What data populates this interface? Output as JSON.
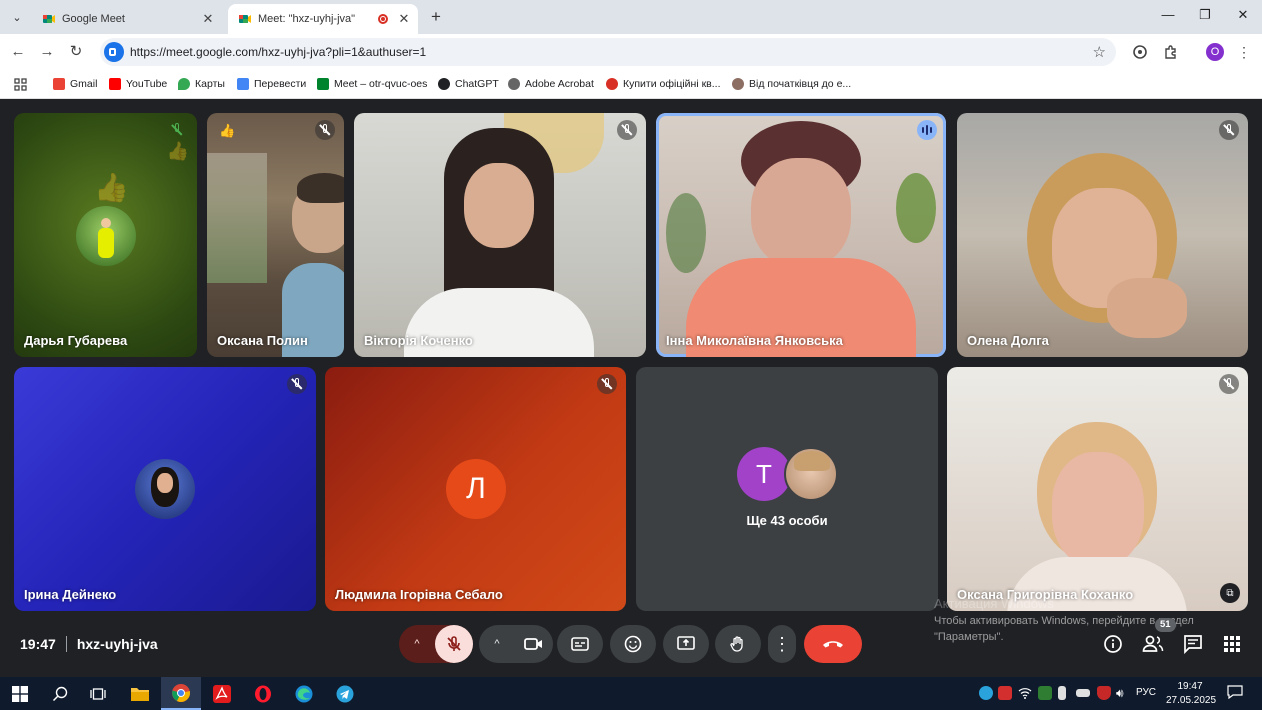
{
  "browser": {
    "tabs": [
      {
        "title": "Google Meet",
        "active": false
      },
      {
        "title": "Meet: \"hxz-uyhj-jva\"",
        "active": true
      }
    ],
    "url": "https://meet.google.com/hxz-uyhj-jva?pli=1&authuser=1",
    "profile_initial": "O",
    "bookmarks": [
      {
        "label": "Gmail",
        "color": "#ea4335"
      },
      {
        "label": "YouTube",
        "color": "#ff0000"
      },
      {
        "label": "Карты",
        "color": "#34a853"
      },
      {
        "label": "Перевести",
        "color": "#4285f4"
      },
      {
        "label": "Meet – otr-qvuc-oes",
        "color": "#00832d"
      },
      {
        "label": "ChatGPT",
        "color": "#202124"
      },
      {
        "label": "Adobe Acrobat",
        "color": "#444444"
      },
      {
        "label": "Купити офіційні кв...",
        "color": "#d93025"
      },
      {
        "label": "Від початківця до е...",
        "color": "#8d6e63"
      }
    ]
  },
  "participants": [
    {
      "name": "Дарья Губарева",
      "status": "muted-green"
    },
    {
      "name": "Оксана Полин",
      "status": "muted",
      "reaction": "👍"
    },
    {
      "name": "Вікторія Коченко",
      "status": "muted"
    },
    {
      "name": "Інна Миколаївна Янковська",
      "status": "speaking"
    },
    {
      "name": "Олена Долга",
      "status": "muted"
    },
    {
      "name": "Ірина Дейнеко",
      "status": "muted"
    },
    {
      "name": "Людмила Ігорівна Себало",
      "status": "muted",
      "initial": "Л"
    },
    {
      "name": "Оксана Григорівна Коханко",
      "status": "muted"
    }
  ],
  "others_tile": {
    "initial": "Т",
    "label": "Ще 43 особи"
  },
  "meeting": {
    "time": "19:47",
    "code": "hxz-uyhj-jva",
    "participants_count": "51"
  },
  "watermark": {
    "line1": "Активация Windows",
    "line2": "Чтобы активировать Windows, перейдите в раздел",
    "line3": "\"Параметры\"."
  },
  "taskbar": {
    "language": "РУС",
    "time": "19:47",
    "date": "27.05.2025"
  },
  "colors": {
    "hangup": "#ea4335",
    "mic_off_active": "#f9dedc",
    "speaking_badge": "#8ab4f8",
    "purple_avatar": "#a142c8",
    "orange_avatar": "#e64a19"
  }
}
